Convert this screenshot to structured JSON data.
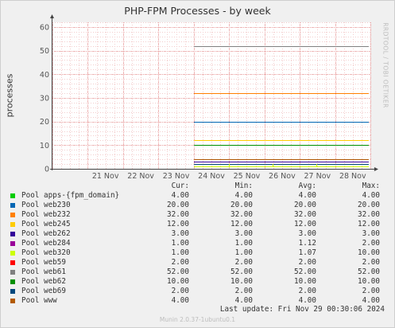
{
  "title": "PHP-FPM Processes - by week",
  "ylabel": "processes",
  "watermark": "RRDTOOL / TOBI OETIKER",
  "footer": {
    "last_update": "Last update: Fri Nov 29 00:30:06 2024",
    "version": "Munin 2.0.37-1ubuntu0.1"
  },
  "legend_headers": [
    "Cur:",
    "Min:",
    "Avg:",
    "Max:"
  ],
  "colors": {
    "background": "#f0f0f0",
    "plot_area": "#ffffff",
    "grid_major": "#e9a0a0",
    "grid_minor": "#f3cccc"
  },
  "chart_data": {
    "type": "line",
    "title": "PHP-FPM Processes - by week",
    "ylabel": "processes",
    "xlabel": "",
    "x_ticks": [
      "21 Nov",
      "22 Nov",
      "23 Nov",
      "24 Nov",
      "25 Nov",
      "26 Nov",
      "27 Nov",
      "28 Nov"
    ],
    "xlim": [
      "20 Nov 2024",
      "29 Nov 2024"
    ],
    "ylim": [
      0,
      62
    ],
    "y_ticks": [
      0,
      10,
      20,
      30,
      40,
      50,
      60
    ],
    "grid": true,
    "data_start": "24 Nov 2024",
    "series": [
      {
        "name": "Pool apps-{fpm_domain}",
        "color": "#00cc00",
        "cur": "4.00",
        "min": "4.00",
        "avg": "4.00",
        "max": "4.00",
        "level": 4
      },
      {
        "name": "Pool web230",
        "color": "#0066b3",
        "cur": "20.00",
        "min": "20.00",
        "avg": "20.00",
        "max": "20.00",
        "level": 20
      },
      {
        "name": "Pool web232",
        "color": "#ff8000",
        "cur": "32.00",
        "min": "32.00",
        "avg": "32.00",
        "max": "32.00",
        "level": 32
      },
      {
        "name": "Pool web245",
        "color": "#ffcc00",
        "cur": "12.00",
        "min": "12.00",
        "avg": "12.00",
        "max": "12.00",
        "level": 12
      },
      {
        "name": "Pool web262",
        "color": "#330099",
        "cur": "3.00",
        "min": "3.00",
        "avg": "3.00",
        "max": "3.00",
        "level": 3
      },
      {
        "name": "Pool web284",
        "color": "#990099",
        "cur": "1.00",
        "min": "1.00",
        "avg": "1.12",
        "max": "2.00",
        "level": 1
      },
      {
        "name": "Pool web320",
        "color": "#ccff00",
        "cur": "1.00",
        "min": "1.00",
        "avg": "1.07",
        "max": "10.00",
        "level": 1
      },
      {
        "name": "Pool web59",
        "color": "#ff0000",
        "cur": "2.00",
        "min": "2.00",
        "avg": "2.00",
        "max": "2.00",
        "level": 2
      },
      {
        "name": "Pool web61",
        "color": "#808080",
        "cur": "52.00",
        "min": "52.00",
        "avg": "52.00",
        "max": "52.00",
        "level": 52
      },
      {
        "name": "Pool web62",
        "color": "#008f00",
        "cur": "10.00",
        "min": "10.00",
        "avg": "10.00",
        "max": "10.00",
        "level": 10
      },
      {
        "name": "Pool web69",
        "color": "#00487d",
        "cur": "2.00",
        "min": "2.00",
        "avg": "2.00",
        "max": "2.00",
        "level": 2
      },
      {
        "name": "Pool www",
        "color": "#b35a00",
        "cur": "4.00",
        "min": "4.00",
        "avg": "4.00",
        "max": "4.00",
        "level": 4
      }
    ]
  }
}
